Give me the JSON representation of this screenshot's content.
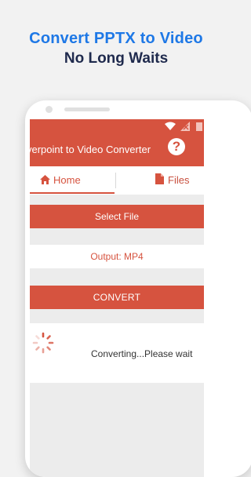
{
  "promo": {
    "line1": "Convert PPTX to Video",
    "line2": "No Long Waits"
  },
  "colors": {
    "accent": "#d6533f",
    "headline_blue": "#1e78e6",
    "headline_navy": "#1f2a4d"
  },
  "app": {
    "title": "verpoint to Video Converter",
    "help_icon": "?"
  },
  "tabs": [
    {
      "label": "Home",
      "icon": "home-icon",
      "active": true
    },
    {
      "label": "Files",
      "icon": "file-icon",
      "active": false
    }
  ],
  "main": {
    "select_file_label": "Select File",
    "output_label": "Output: MP4",
    "convert_label": "CONVERT",
    "progress_text": "Converting...Please wait"
  }
}
